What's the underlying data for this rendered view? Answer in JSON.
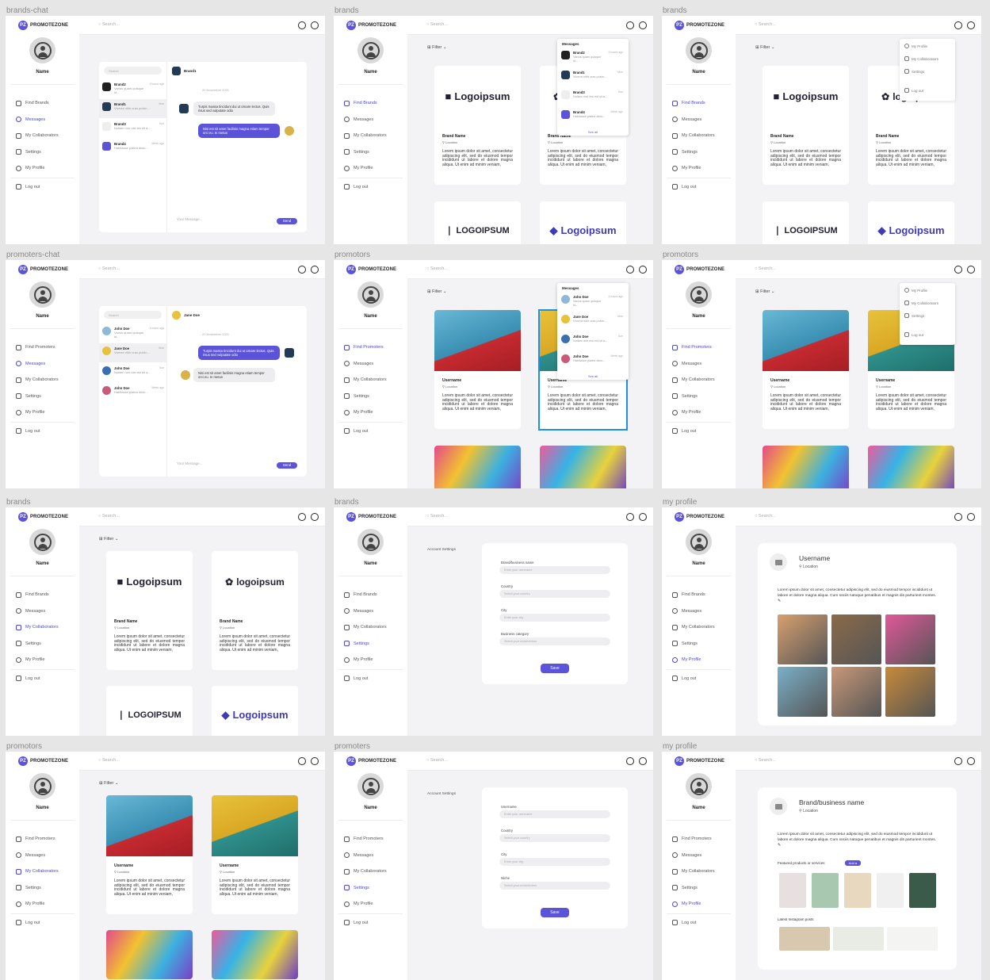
{
  "app": {
    "logo": "PROMOTEZONE",
    "logo_mark": "PZ",
    "search_placeholder": "Search...",
    "user_name": "Name",
    "logout": "Log out",
    "filter": "Filter"
  },
  "frames": [
    {
      "label": "brands-chat",
      "find_label": "Find Brands",
      "active": "Messages"
    },
    {
      "label": "brands",
      "find_label": "Find Brands",
      "active": "Find Brands"
    },
    {
      "label": "brands",
      "find_label": "Find Brands",
      "active": "Find Brands"
    },
    {
      "label": "promoters-chat",
      "find_label": "Find Promoters",
      "active": "Messages"
    },
    {
      "label": "promotors",
      "find_label": "Find Promoters",
      "active": "Find Promoters"
    },
    {
      "label": "promotors",
      "find_label": "Find Promoters",
      "active": "Find Promoters"
    },
    {
      "label": "brands",
      "find_label": "Find Brands",
      "active": "My Collaborators"
    },
    {
      "label": "brands",
      "find_label": "Find Brands",
      "active": "Settings"
    },
    {
      "label": "my profile",
      "find_label": "Find Brands",
      "active": "My Profile"
    },
    {
      "label": "promotors",
      "find_label": "Find Promoters",
      "active": "My Collaborators"
    },
    {
      "label": "promoters",
      "find_label": "Find Promoters",
      "active": "Settings"
    },
    {
      "label": "my profile",
      "find_label": "Find Promoters",
      "active": "My Profile"
    }
  ],
  "nav": [
    "Messages",
    "My Collaborators",
    "Settings",
    "My Profile"
  ],
  "brand_card": {
    "title": "Brand Name",
    "location": "Location",
    "desc": "Lorem ipsum dolor sit amet, consectetur adipiscing elit, sed do eiusmod tempor incididunt ut labore et dolore magna aliqua. Ut enim ad minim veniam,"
  },
  "promoter_card": {
    "title": "Username",
    "location": "Location"
  },
  "logos": [
    "Logoipsum",
    "logoipsum",
    "LOGOIPSUM",
    "Logoipsum"
  ],
  "chat": {
    "search": "Search",
    "date": "20 November 2021",
    "message_placeholder": "Your Message...",
    "send": "Send",
    "brands_head": "Brand1",
    "brands_list": [
      {
        "name": "Brand2",
        "time": "4 hours ago",
        "text": "Varius quam quisque id..."
      },
      {
        "name": "Brand1",
        "time": "Mon",
        "text": "Viverra nibh cras pulvin..."
      },
      {
        "name": "Brand3",
        "time": "Sun",
        "text": "Nullam non nisi est sit a..."
      },
      {
        "name": "Brand4",
        "time": "Week ago",
        "text": "Habitasse platea dictu..."
      }
    ],
    "promoters_head": "Jane Doe",
    "promoters_list": [
      {
        "name": "John Doe",
        "time": "4 hours ago",
        "text": "Varius quam quisque id..."
      },
      {
        "name": "Jane Doe",
        "time": "Mon",
        "text": "Viverra nibh cras pulvin..."
      },
      {
        "name": "John Doe",
        "time": "Sun",
        "text": "Nullam non nisi est sit a..."
      },
      {
        "name": "John Doe",
        "time": "Week ago",
        "text": "Habitasse platea dictu..."
      }
    ],
    "msg1": "Turpis massa tincidunt dui ut ornare lectus. Quis risus sed vulputate odio",
    "msg2": "Nisi est sit amet facilisis magna etiam tempor orci eu. In metus"
  },
  "dropdown": {
    "title": "Messages",
    "see_all": "See all"
  },
  "profile_menu": [
    "My Profile",
    "My Collaborators",
    "Settings",
    "Log out"
  ],
  "settings": {
    "account": "Account Settings",
    "brand_fields": [
      {
        "label": "Brand/business name",
        "placeholder": "Enter your username"
      },
      {
        "label": "Country",
        "placeholder": "Select your country"
      },
      {
        "label": "City",
        "placeholder": "Enter your city"
      },
      {
        "label": "Business category",
        "placeholder": "Select your niche/niches"
      }
    ],
    "promoter_fields": [
      {
        "label": "Username",
        "placeholder": "Enter your username"
      },
      {
        "label": "Country",
        "placeholder": "Select your country"
      },
      {
        "label": "City",
        "placeholder": "Enter your city"
      },
      {
        "label": "Niche",
        "placeholder": "Select your niche/niches"
      }
    ],
    "save": "Save"
  },
  "profile": {
    "promoter_title": "Username",
    "brand_title": "Brand/business name",
    "location": "Location",
    "bio": "Lorem ipsum dolor sit amet, consectetur adipiscing elit, sed do eiusmod tempor incididunt ut labore et dolore magna aliqua. Cum sociis natoque penatibus et magnis dis parturient montes.",
    "featured": "Featured products or services",
    "add": "Add",
    "instagram": "Latest Instagram posts"
  },
  "colors": {
    "accent": "#5b54d8",
    "bg": "#f3f3f5",
    "selection": "#1e90e8"
  }
}
